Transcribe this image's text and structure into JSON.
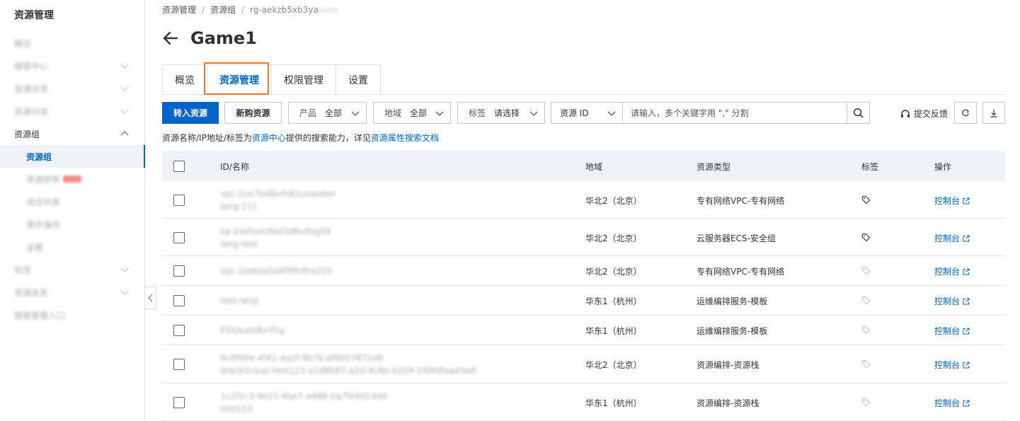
{
  "sidebar": {
    "title": "资源管理",
    "items": [
      {
        "label": "概览",
        "blurred": true,
        "chevron": false
      },
      {
        "label": "搜索中心",
        "blurred": true,
        "chevron": true
      },
      {
        "label": "资源目录",
        "blurred": true,
        "chevron": true
      },
      {
        "label": "资源分组",
        "blurred": true,
        "chevron": true
      },
      {
        "label": "资源组",
        "blurred": false,
        "chevron": true
      },
      {
        "label": "资源组",
        "blurred": false,
        "chevron": false,
        "active": true
      },
      {
        "label": "资源转移",
        "blurred": true,
        "chevron": false,
        "badge": true
      },
      {
        "label": "成员列表",
        "blurred": true,
        "chevron": false
      },
      {
        "label": "事件操作",
        "blurred": true,
        "chevron": false
      },
      {
        "label": "设置",
        "blurred": true,
        "chevron": false
      },
      {
        "label": "标签",
        "blurred": true,
        "chevron": true
      },
      {
        "label": "资源关系",
        "blurred": true,
        "chevron": true
      },
      {
        "label": "智能客服入口",
        "blurred": true,
        "chevron": false
      }
    ]
  },
  "breadcrumb": {
    "items": [
      "资源管理",
      "资源组"
    ],
    "current": "rg-aekzb5xb3ya"
  },
  "page": {
    "title": "Game1"
  },
  "tabs": [
    {
      "label": "概览"
    },
    {
      "label": "资源管理",
      "active": true
    },
    {
      "label": "权限管理"
    },
    {
      "label": "设置"
    }
  ],
  "toolbar": {
    "transfer_label": "转入资源",
    "buy_label": "新购资源",
    "product": {
      "label": "产品",
      "value": "全部"
    },
    "region": {
      "label": "地域",
      "value": "全部"
    },
    "tag": {
      "label": "标签",
      "value": "请选择"
    },
    "resource_id": {
      "label": "资源 ID"
    },
    "search_placeholder": "请输入，多个关键字用 \",\" 分割",
    "feedback_label": "提交反馈"
  },
  "hint": {
    "prefix": "资源名称/IP地址/标签为",
    "link1": "资源中心",
    "middle": "提供的搜索能力，详见",
    "link2": "资源属性搜索文档"
  },
  "table": {
    "headers": {
      "id": "ID/名称",
      "region": "地域",
      "type": "资源类型",
      "tag": "标签",
      "op": "操作"
    },
    "rows": [
      {
        "id_lines": [
          "vpc-2ze7b48vrh83uvaieboi",
          "lang-111"
        ],
        "region": "华北2（北京）",
        "type": "专有网络VPC-专有网络",
        "tagged": true,
        "op": "控制台"
      },
      {
        "id_lines": [
          "sg-2zehum9bd3d6u9sg58",
          "lang-test"
        ],
        "region": "华北2（北京）",
        "type": "云服务器ECS-安全组",
        "tagged": true,
        "op": "控制台"
      },
      {
        "id_lines": [
          "vpc-2zeksa5d4f9fh8hs225"
        ],
        "region": "华北2（北京）",
        "type": "专有网络VPC-专有网络",
        "tagged": false,
        "op": "控制台"
      },
      {
        "id_lines": [
          "test-lang"
        ],
        "region": "华东1（杭州）",
        "type": "运维编排服务-模板",
        "tagged": false,
        "op": "控制台"
      },
      {
        "id_lines": [
          "ESSAutoBvrf5g"
        ],
        "region": "华东1（杭州）",
        "type": "运维编排服务-模板",
        "tagged": false,
        "op": "控制台"
      },
      {
        "id_lines": [
          "0c0f60e-4f41-4a2f-9b7b-af8b07871e6",
          "StackGroup-test123-a1d8b87-a2d-4c8b-b259-1f09dfaa45e8"
        ],
        "region": "华北2（北京）",
        "type": "资源编排-资源栈",
        "tagged": false,
        "op": "控制台"
      },
      {
        "id_lines": [
          "1c2f1c3-9e21-4be7-a488-ba7fe9d14dd",
          "test123"
        ],
        "region": "华东1（杭州）",
        "type": "资源编排-资源栈",
        "tagged": false,
        "op": "控制台"
      }
    ]
  }
}
